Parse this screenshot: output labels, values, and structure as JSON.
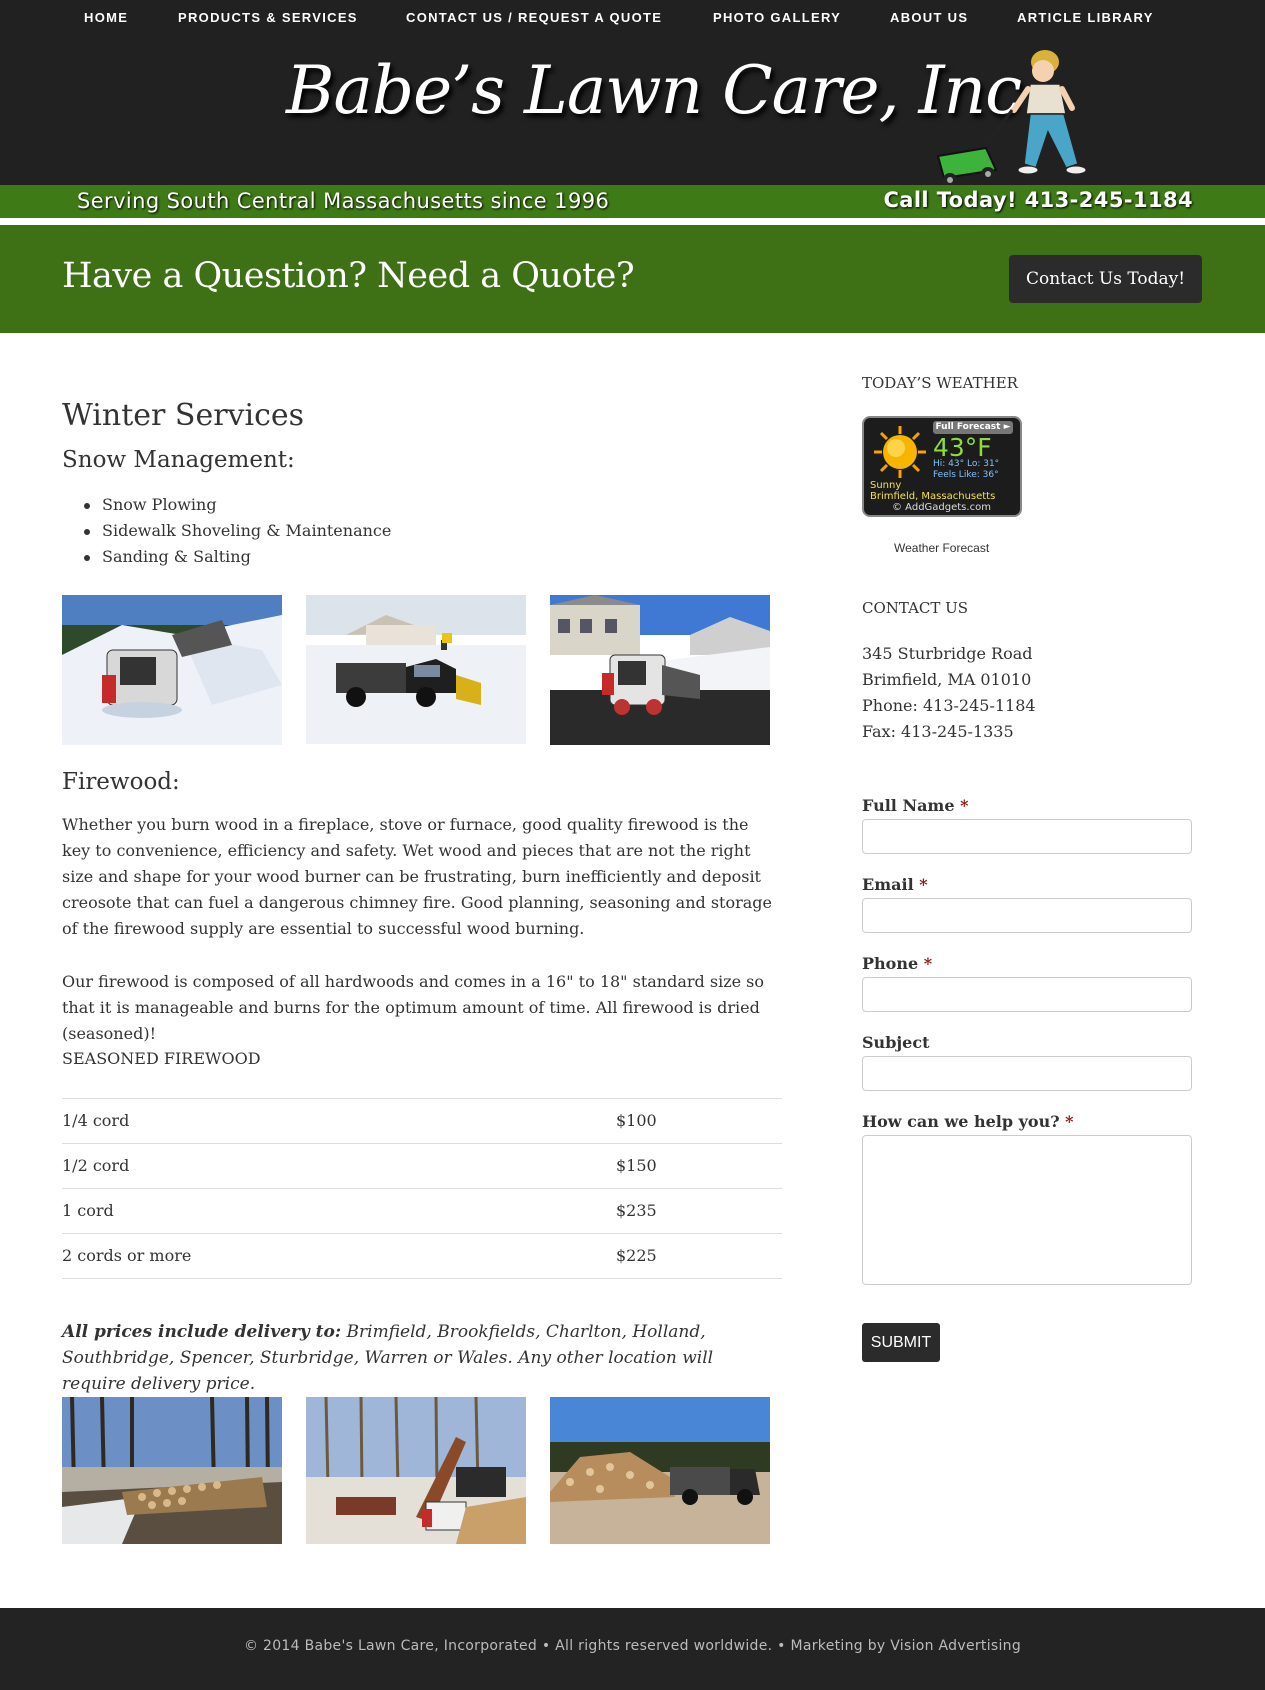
{
  "nav": {
    "items": [
      "HOME",
      "PRODUCTS & SERVICES",
      "CONTACT US / REQUEST A QUOTE",
      "PHOTO GALLERY",
      "ABOUT US",
      "ARTICLE LIBRARY"
    ]
  },
  "header": {
    "logo_text": "Babe’s Lawn Care, Inc.",
    "tagline": "Serving South Central Massachusetts since 1996",
    "call_text": "Call Today! 413-245-1184"
  },
  "cta": {
    "heading": "Have a Question? Need a Quote?",
    "button_label": "Contact Us Today!"
  },
  "main": {
    "title": "Winter Services",
    "snow_heading": "Snow Management:",
    "snow_services": [
      "Snow Plowing",
      "Sidewalk Shoveling & Maintenance",
      "Sanding & Salting"
    ],
    "firewood_heading": "Firewood:",
    "firewood_para1": "Whether you burn wood in a fireplace, stove or furnace, good quality firewood is the key to convenience, efficiency and safety. Wet wood and pieces that are not the right size and shape for your wood burner can be frustrating, burn inefficiently and deposit creosote that can fuel a dangerous chimney fire. Good planning, seasoning and storage of the firewood supply are essential to successful wood burning.",
    "firewood_para2": "Our firewood is composed of all hardwoods and comes in a 16\" to 18\" standard size so that it is manageable and burns for the optimum amount of time. All firewood is dried (seasoned)!",
    "price_heading": "SEASONED FIREWOOD",
    "prices": [
      {
        "item": "1/4 cord",
        "price": "$100"
      },
      {
        "item": "1/2 cord",
        "price": "$150"
      },
      {
        "item": "1 cord",
        "price": "$235"
      },
      {
        "item": "2 cords or more",
        "price": "$225"
      }
    ],
    "delivery_lead": "All prices include delivery to:",
    "delivery_text": " Brimfield, Brookfields, Charlton, Holland, Southbridge, Spencer, Sturbridge, Warren or Wales. Any other location will require delivery price."
  },
  "sidebar": {
    "weather_heading": "TODAY’S WEATHER",
    "weather": {
      "full_forecast": "Full Forecast ►",
      "temp": "43°F",
      "hilo": "Hi: 43°   Lo: 31°",
      "feels": "Feels Like: 36°",
      "condition": "Sunny",
      "location": "Brimfield, Massachusetts",
      "credit": "© AddGadgets.com"
    },
    "weather_link": "Weather Forecast",
    "contact_heading": "CONTACT US",
    "address": [
      "345 Sturbridge Road",
      "Brimfield, MA 01010",
      "Phone: 413-245-1184",
      "Fax: 413-245-1335"
    ]
  },
  "form": {
    "full_name_label": "Full Name",
    "email_label": "Email",
    "phone_label": "Phone",
    "subject_label": "Subject",
    "message_label": "How can we help you?",
    "required_mark": "*",
    "submit_label": "SUBMIT"
  },
  "footer": {
    "text": "© 2014 Babe's Lawn Care, Incorporated • All rights reserved worldwide. • Marketing by Vision Advertising"
  }
}
